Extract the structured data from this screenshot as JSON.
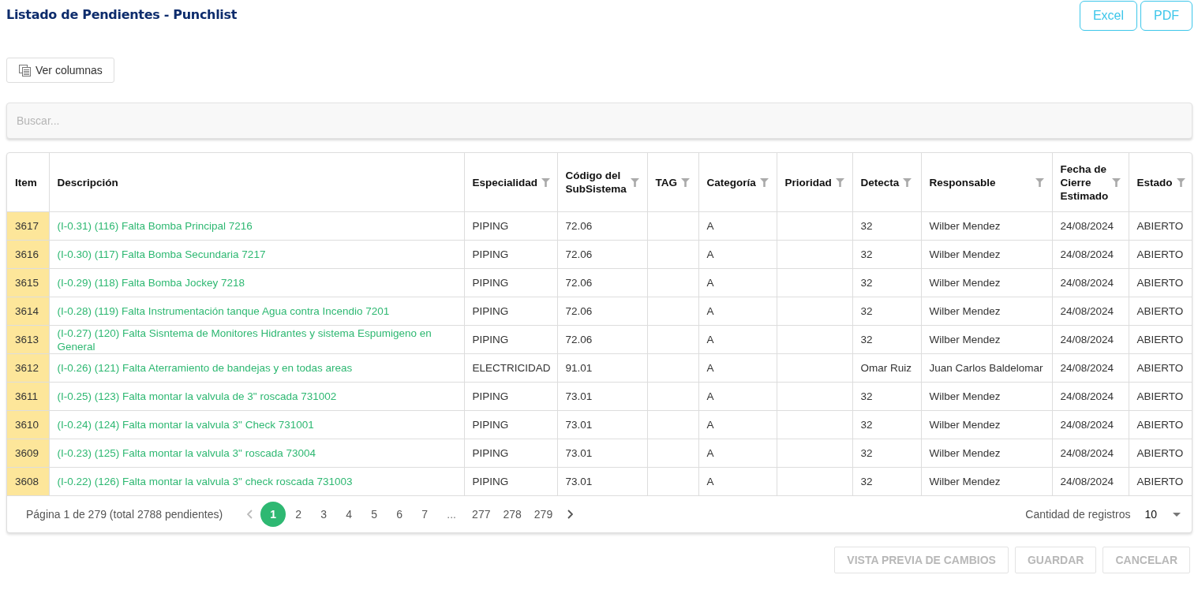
{
  "title": "Listado de Pendientes - Punchlist",
  "export_buttons": [
    "Excel",
    "PDF"
  ],
  "columns_button": "Ver columnas",
  "search": {
    "placeholder": "Buscar..."
  },
  "table": {
    "columns": [
      {
        "label": "Item",
        "filter": false
      },
      {
        "label": "Descripción",
        "filter": false
      },
      {
        "label": "Especialidad",
        "filter": true
      },
      {
        "label": "Código del SubSistema",
        "filter": true
      },
      {
        "label": "TAG",
        "filter": true
      },
      {
        "label": "Categoría",
        "filter": true
      },
      {
        "label": "Prioridad",
        "filter": true
      },
      {
        "label": "Detecta",
        "filter": true
      },
      {
        "label": "Responsable",
        "filter": true
      },
      {
        "label": "Fecha de Cierre Estimado",
        "filter": true
      },
      {
        "label": "Estado",
        "filter": true
      }
    ],
    "rows": [
      [
        "3617",
        "(I-0.31) (116) Falta Bomba Principal 7216",
        "PIPING",
        "72.06",
        "",
        "A",
        "",
        "32",
        "Wilber Mendez",
        "24/08/2024",
        "ABIERTO"
      ],
      [
        "3616",
        "(I-0.30) (117) Falta Bomba Secundaria 7217",
        "PIPING",
        "72.06",
        "",
        "A",
        "",
        "32",
        "Wilber Mendez",
        "24/08/2024",
        "ABIERTO"
      ],
      [
        "3615",
        "(I-0.29) (118) Falta Bomba Jockey 7218",
        "PIPING",
        "72.06",
        "",
        "A",
        "",
        "32",
        "Wilber Mendez",
        "24/08/2024",
        "ABIERTO"
      ],
      [
        "3614",
        "(I-0.28) (119) Falta Instrumentación tanque Agua contra Incendio 7201",
        "PIPING",
        "72.06",
        "",
        "A",
        "",
        "32",
        "Wilber Mendez",
        "24/08/2024",
        "ABIERTO"
      ],
      [
        "3613",
        "(I-0.27) (120) Falta Sisntema de Monitores Hidrantes y sistema Espumigeno en General",
        "PIPING",
        "72.06",
        "",
        "A",
        "",
        "32",
        "Wilber Mendez",
        "24/08/2024",
        "ABIERTO"
      ],
      [
        "3612",
        "(I-0.26) (121) Falta Aterramiento de bandejas y en todas areas",
        "ELECTRICIDAD",
        "91.01",
        "",
        "A",
        "",
        "Omar Ruiz",
        "Juan Carlos Baldelomar",
        "24/08/2024",
        "ABIERTO"
      ],
      [
        "3611",
        "(I-0.25) (123) Falta montar la valvula de 3\" roscada 731002",
        "PIPING",
        "73.01",
        "",
        "A",
        "",
        "32",
        "Wilber Mendez",
        "24/08/2024",
        "ABIERTO"
      ],
      [
        "3610",
        "(I-0.24) (124) Falta montar la valvula 3\" Check 731001",
        "PIPING",
        "73.01",
        "",
        "A",
        "",
        "32",
        "Wilber Mendez",
        "24/08/2024",
        "ABIERTO"
      ],
      [
        "3609",
        "(I-0.23) (125) Falta montar la valvula 3\" roscada 73004",
        "PIPING",
        "73.01",
        "",
        "A",
        "",
        "32",
        "Wilber Mendez",
        "24/08/2024",
        "ABIERTO"
      ],
      [
        "3608",
        "(I-0.22) (126) Falta montar la valvula 3\" check roscada 731003",
        "PIPING",
        "73.01",
        "",
        "A",
        "",
        "32",
        "Wilber Mendez",
        "24/08/2024",
        "ABIERTO"
      ]
    ]
  },
  "pager": {
    "summary": "Página 1 de 279 (total 2788 pendientes)",
    "pages": [
      {
        "label": "1",
        "kind": "page",
        "selected": true
      },
      {
        "label": "2",
        "kind": "page",
        "selected": false
      },
      {
        "label": "3",
        "kind": "page",
        "selected": false
      },
      {
        "label": "4",
        "kind": "page",
        "selected": false
      },
      {
        "label": "5",
        "kind": "page",
        "selected": false
      },
      {
        "label": "6",
        "kind": "page",
        "selected": false
      },
      {
        "label": "7",
        "kind": "page",
        "selected": false
      },
      {
        "label": "...",
        "kind": "ellipsis",
        "selected": false
      },
      {
        "label": "277",
        "kind": "page",
        "selected": false
      },
      {
        "label": "278",
        "kind": "page",
        "selected": false
      },
      {
        "label": "279",
        "kind": "page",
        "selected": false
      }
    ],
    "page_size_label": "Cantidad de registros",
    "page_size": "10"
  },
  "actions": [
    {
      "label": "VISTA PREVIA DE CAMBIOS",
      "disabled": true
    },
    {
      "label": "GUARDAR",
      "disabled": true
    },
    {
      "label": "CANCELAR",
      "disabled": true
    }
  ]
}
